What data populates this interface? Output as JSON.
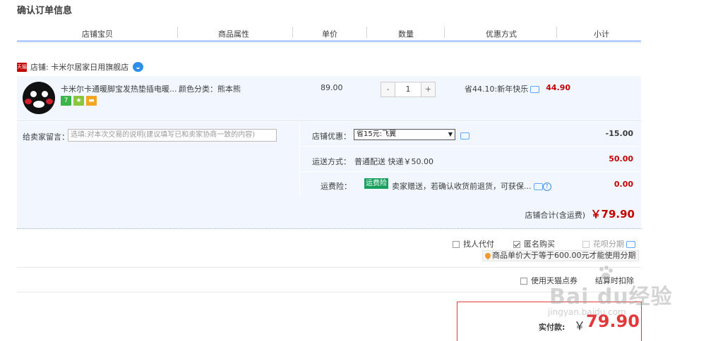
{
  "page": {
    "title": "确认订单信息"
  },
  "columns": [
    "店铺宝贝",
    "商品属性",
    "单价",
    "数量",
    "优惠方式",
    "小计"
  ],
  "shop": {
    "icon_text": "天猫",
    "label": "店铺: 卡米尔居家日用旗舰店"
  },
  "item": {
    "name": "卡米尔卡通暖脚宝发热垫插电暖...",
    "attribute": "颜色分类：熊本熊",
    "unit_price": "89.00",
    "quantity": "1",
    "minus": "-",
    "plus": "+",
    "promotion": "省44.10:新年快乐",
    "subtotal": "44.90",
    "badges": [
      {
        "text": "7",
        "color": "#3ab54a"
      },
      {
        "text": "★",
        "color": "#8cc63f"
      },
      {
        "text": "▬",
        "color": "#f5a623"
      }
    ]
  },
  "order": {
    "message_label": "给卖家留言：",
    "message_placeholder": "选填:对本次交易的说明(建议填写已和卖家协商一致的内容)",
    "shop_promo_label": "店铺优惠：",
    "shop_promo_selected": "省15元:飞翼",
    "shop_promo_arrow": "▼",
    "shop_promo_value": "-15.00",
    "shipping_label": "运送方式：",
    "shipping_method": "普通配送 快递￥50.00",
    "shipping_value": "50.00",
    "insurance_label": "运费险：",
    "insurance_tag": "运费险",
    "insurance_desc": "卖家赠送，若确认收货前退货，可获保...",
    "insurance_value": "0.00",
    "question_mark": "?",
    "shop_total_label": "店铺合计(含运费)",
    "shop_total_value": "￥79.90"
  },
  "options": {
    "proxy_pay": "找人代付",
    "anonymous": "匿名购买",
    "installment": "花呗分期",
    "installment_hint": "商品单价大于等于600.00元才能使用分期",
    "tmall_points": "使用天猫点券",
    "tmall_points_note": "结算时扣除"
  },
  "payment": {
    "label": "实付款:",
    "currency": "￥",
    "amount": "79.90"
  },
  "watermark": {
    "brand": "Bai du经验",
    "url": "jingyan.baidu.com"
  },
  "colors": {
    "accent_red": "#c40000",
    "pay_red": "#e4393c",
    "row_bg": "#f2f7ff",
    "header_line": "#b2d1ff"
  }
}
